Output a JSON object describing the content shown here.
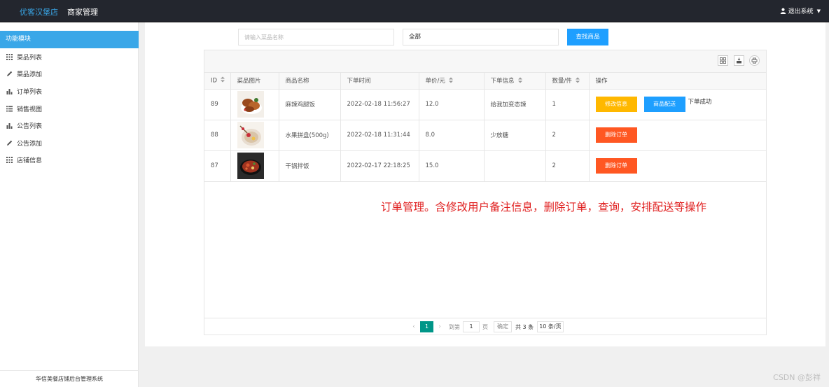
{
  "header": {
    "brand": "优客汉堡店",
    "nav_title": "商家管理",
    "user_menu": "退出系统"
  },
  "sidebar": {
    "title": "功能模块",
    "items": [
      {
        "label": "菜品列表",
        "icon": "grid-icon"
      },
      {
        "label": "菜品添加",
        "icon": "pencil-icon"
      },
      {
        "label": "订单列表",
        "icon": "bar-chart-icon"
      },
      {
        "label": "销售视图",
        "icon": "list-icon"
      },
      {
        "label": "公告列表",
        "icon": "bar-chart-icon"
      },
      {
        "label": "公告添加",
        "icon": "pencil-icon"
      },
      {
        "label": "店铺信息",
        "icon": "grid-icon"
      }
    ],
    "footer": "华信美餐店铺后台管理系统"
  },
  "search": {
    "placeholder": "请输入菜品名称",
    "select_value": "全部",
    "button_label": "查找商品"
  },
  "table": {
    "columns": [
      "ID",
      "菜品图片",
      "商品名称",
      "下单时间",
      "单价/元",
      "下单信息",
      "数量/件",
      "操作"
    ],
    "rows": [
      {
        "id": "89",
        "name": "麻辣鸡腿饭",
        "time": "2022-02-18 11:56:27",
        "price": "12.0",
        "note": "给我加变态辣",
        "qty": "1",
        "actions": [
          "修改信息",
          "商品配送"
        ],
        "status": "下单成功"
      },
      {
        "id": "88",
        "name": "水果拼盘(500g)",
        "time": "2022-02-18 11:31:44",
        "price": "8.0",
        "note": "少放糖",
        "qty": "2",
        "actions": [
          "删除订单"
        ],
        "status": ""
      },
      {
        "id": "87",
        "name": "干锅拌饭",
        "time": "2022-02-17 22:18:25",
        "price": "15.0",
        "note": "",
        "qty": "2",
        "actions": [
          "删除订单"
        ],
        "status": ""
      }
    ]
  },
  "annotation": "订单管理。含修改用户备注信息，删除订单，查询，安排配送等操作",
  "pagination": {
    "current_page": "1",
    "goto_label": "到第",
    "goto_value": "1",
    "page_unit": "页",
    "confirm_label": "确定",
    "total_label": "共 3 条",
    "page_size": "10 条/页"
  },
  "watermark": "CSDN @彭祥",
  "colors": {
    "header_bg": "#23262e",
    "accent_blue": "#1e9fff",
    "sidebar_active": "#3aa7e8",
    "warn": "#ffb800",
    "danger": "#ff5722",
    "pager_active": "#009688",
    "annotation_red": "#e02020"
  }
}
